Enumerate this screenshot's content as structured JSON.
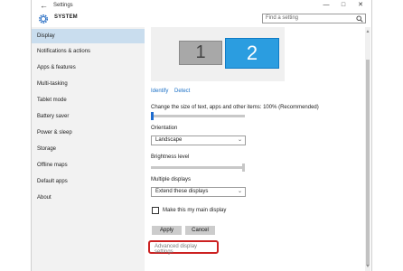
{
  "window": {
    "title": "Settings",
    "back_glyph": "←",
    "minimize": "—",
    "maximize": "□",
    "close": "✕"
  },
  "header": {
    "section": "SYSTEM",
    "gear_icon": "gear-icon"
  },
  "search": {
    "placeholder": "Find a setting",
    "icon": "search-icon"
  },
  "sidebar": {
    "items": [
      {
        "label": "Display",
        "active": true
      },
      {
        "label": "Notifications & actions"
      },
      {
        "label": "Apps & features"
      },
      {
        "label": "Multi-tasking"
      },
      {
        "label": "Tablet mode"
      },
      {
        "label": "Battery saver"
      },
      {
        "label": "Power & sleep"
      },
      {
        "label": "Storage"
      },
      {
        "label": "Offline maps"
      },
      {
        "label": "Default apps"
      },
      {
        "label": "About"
      }
    ]
  },
  "display": {
    "monitor1": "1",
    "monitor2": "2",
    "identify": "Identify",
    "detect": "Detect",
    "scale_label": "Change the size of text, apps and other items: 100% (Recommended)",
    "scale_value": 0,
    "orientation_label": "Orientation",
    "orientation_value": "Landscape",
    "brightness_label": "Brightness level",
    "brightness_value": 1,
    "multiple_label": "Multiple displays",
    "multiple_value": "Extend these displays",
    "main_display_label": "Make this my main display",
    "apply": "Apply",
    "cancel": "Cancel",
    "advanced": "Advanced display settings"
  },
  "colors": {
    "accent": "#2b9de0",
    "active_nav": "#c9ddee",
    "highlight": "#cc2121"
  }
}
